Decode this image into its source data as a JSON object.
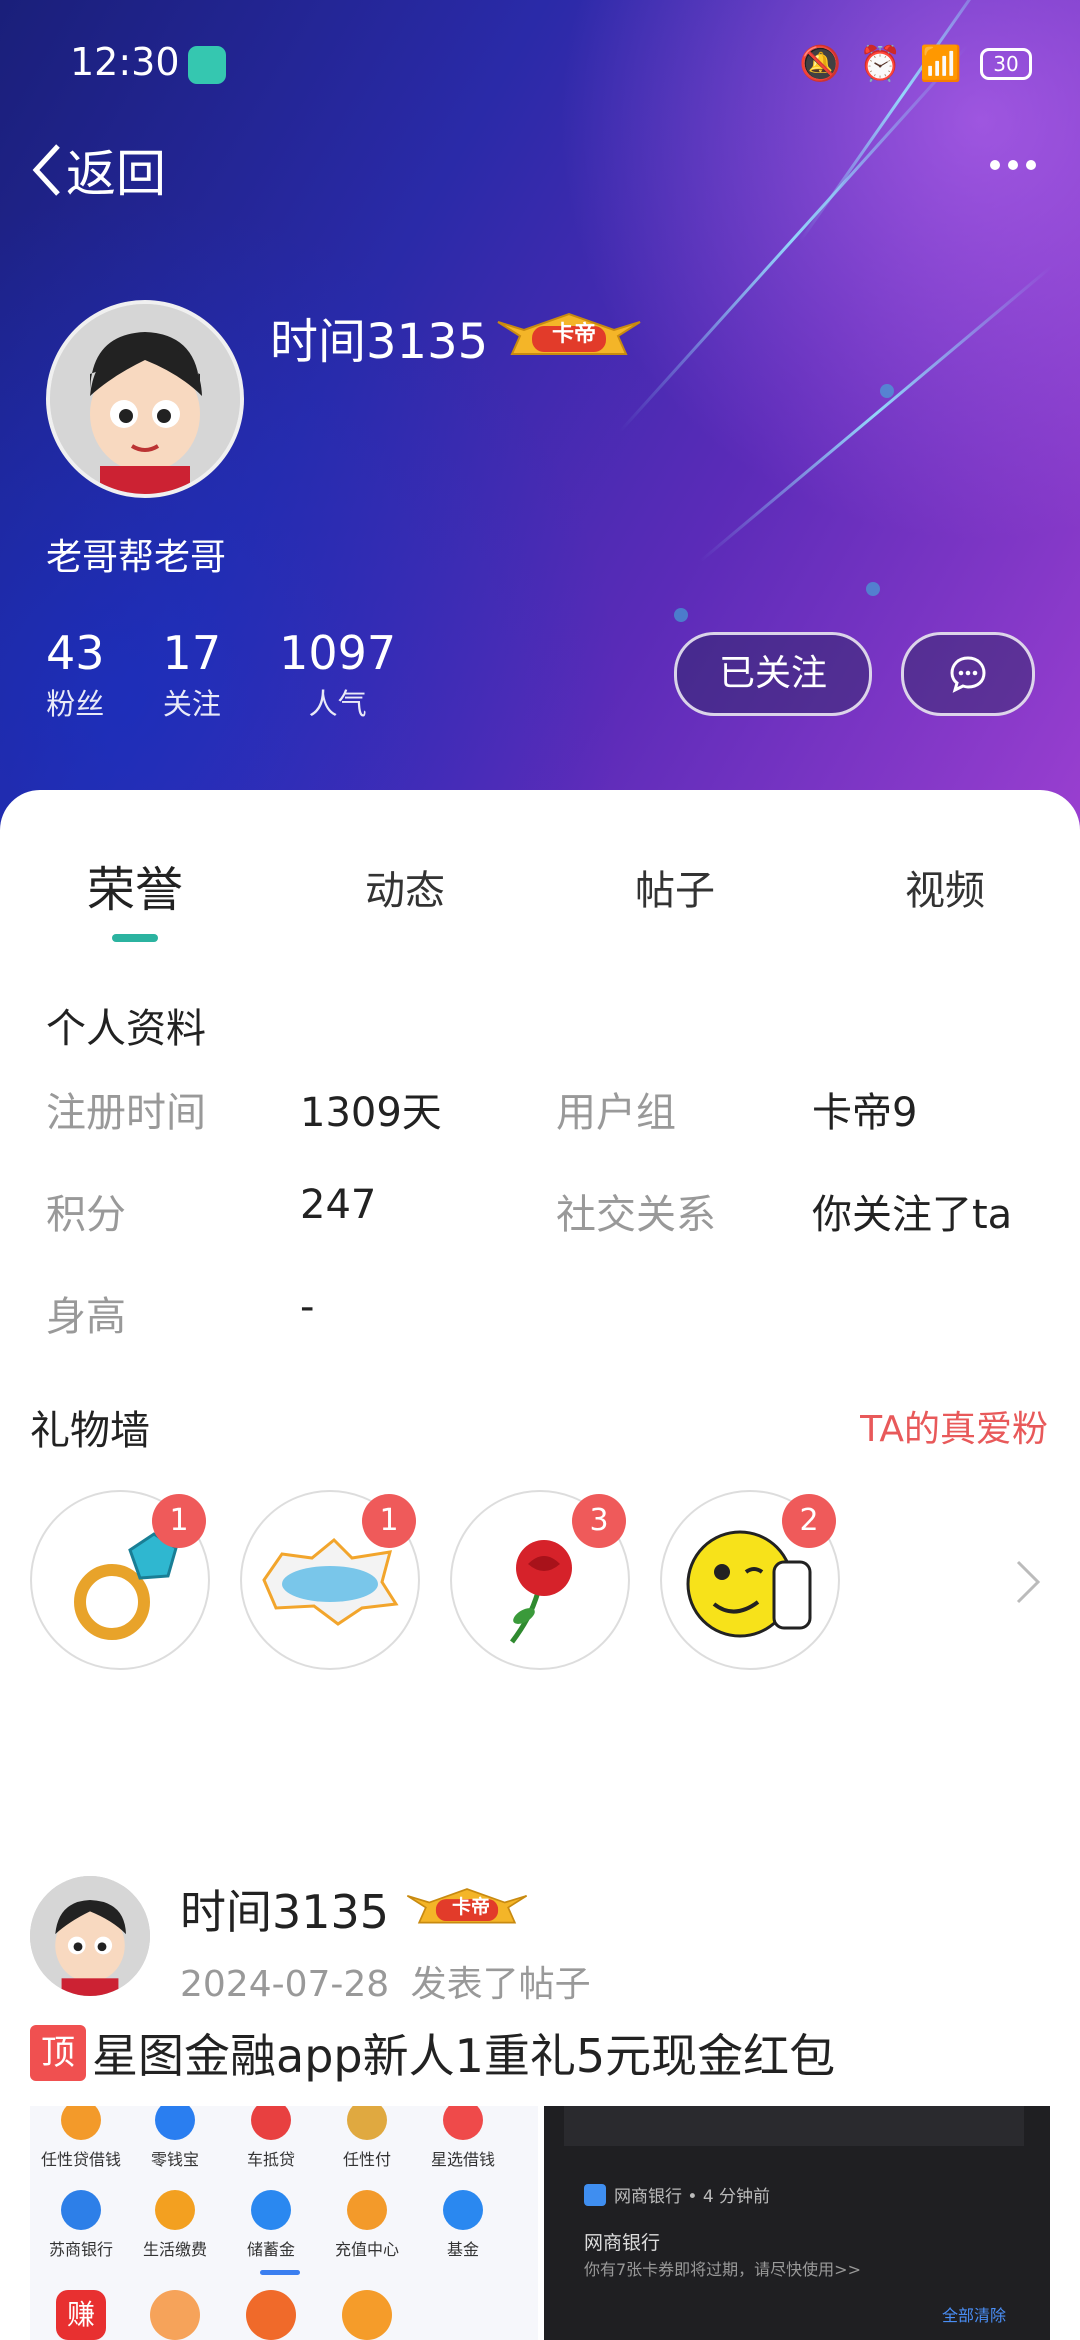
{
  "status_bar": {
    "time": "12:30",
    "battery": "30"
  },
  "nav": {
    "back_label": "返回"
  },
  "profile": {
    "username": "时间3135",
    "badge_label": "卡帝",
    "bio": "老哥帮老哥",
    "stats": [
      {
        "value": "43",
        "label": "粉丝"
      },
      {
        "value": "17",
        "label": "关注"
      },
      {
        "value": "1097",
        "label": "人气"
      }
    ],
    "follow_button": "已关注"
  },
  "tabs": [
    "荣誉",
    "动态",
    "帖子",
    "视频"
  ],
  "info_section": {
    "title": "个人资料",
    "rows": [
      {
        "k1": "注册时间",
        "v1": "1309天",
        "k2": "用户组",
        "v2": "卡帝9"
      },
      {
        "k1": "积分",
        "v1": "247",
        "k2": "社交关系",
        "v2": "你关注了ta"
      },
      {
        "k1": "身高",
        "v1": "-"
      }
    ]
  },
  "gifts": {
    "title": "礼物墙",
    "link": "TA的真爱粉",
    "items": [
      {
        "icon": "ring-icon",
        "count": "1"
      },
      {
        "icon": "cool-icon",
        "count": "1"
      },
      {
        "icon": "rose-icon",
        "count": "3"
      },
      {
        "icon": "thumbs-up-smiley-icon",
        "count": "2"
      }
    ]
  },
  "post": {
    "author": "时间3135",
    "badge_label": "卡帝",
    "date": "2024-07-28",
    "action": "发表了帖子",
    "top_tag": "顶",
    "title": "星图金融app新人1重礼5元现金红包",
    "thumb1": {
      "row1": [
        "任性贷借钱",
        "零钱宝",
        "车抵贷",
        "任性付",
        "星选借钱"
      ],
      "row2": [
        "苏商银行",
        "生活缴费",
        "储蓄金",
        "充值中心",
        "基金"
      ],
      "row3": [
        "赚",
        "",
        "",
        ""
      ]
    },
    "thumb2": {
      "notif_app": "网商银行 • 4 分钟前",
      "notif_title": "网商银行",
      "notif_body": "你有7张卡券即将过期，请尽快使用>>",
      "clear_all": "全部清除"
    }
  },
  "colors": {
    "accent": "#2bb3a0",
    "red": "#ef5a5a",
    "link": "#e8595a"
  }
}
